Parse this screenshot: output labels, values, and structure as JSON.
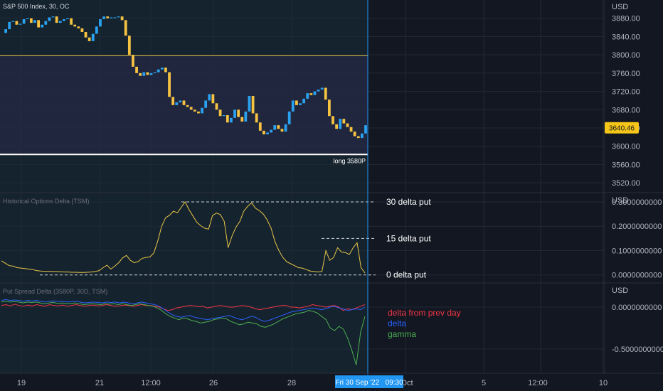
{
  "chart_data": [
    {
      "type": "candlestick",
      "title": "S&P 500 Index, 30, OC",
      "currency": "USD",
      "ylim": [
        3500,
        3920
      ],
      "yticks": [
        3520,
        3560,
        3600,
        3640,
        3680,
        3720,
        3760,
        3800,
        3840,
        3880
      ],
      "ytick_labels": [
        "3520.00",
        "3560.00",
        "3600.00",
        "3640.00",
        "3680.00",
        "3720.00",
        "3760.00",
        "3800.00",
        "3840.00",
        "3880.00"
      ],
      "last_price": "3640.46",
      "last_value": 3640.46,
      "levels": [
        {
          "value": 3798,
          "color": "#e8c547"
        },
        {
          "value": 3582,
          "color": "#ffffff",
          "label": "long 3580P"
        }
      ],
      "band": {
        "from": 3798,
        "to": 3582
      },
      "closes": [
        3848,
        3856,
        3872,
        3874,
        3866,
        3868,
        3878,
        3880,
        3870,
        3876,
        3860,
        3866,
        3874,
        3882,
        3884,
        3870,
        3874,
        3878,
        3880,
        3866,
        3862,
        3858,
        3850,
        3838,
        3830,
        3846,
        3862,
        3878,
        3884,
        3880,
        3882,
        3882,
        3884,
        3876,
        3842,
        3800,
        3774,
        3760,
        3754,
        3762,
        3756,
        3760,
        3762,
        3768,
        3772,
        3762,
        3708,
        3690,
        3696,
        3700,
        3690,
        3686,
        3680,
        3676,
        3672,
        3684,
        3700,
        3714,
        3694,
        3680,
        3666,
        3668,
        3652,
        3662,
        3680,
        3664,
        3654,
        3676,
        3710,
        3672,
        3652,
        3634,
        3626,
        3630,
        3636,
        3646,
        3638,
        3632,
        3648,
        3676,
        3700,
        3690,
        3694,
        3704,
        3716,
        3712,
        3720,
        3724,
        3728,
        3702,
        3666,
        3648,
        3638,
        3660,
        3650,
        3642,
        3632,
        3622,
        3618,
        3628,
        3646
      ]
    },
    {
      "type": "line",
      "title": "Historical Options Delta (TSM)",
      "currency": "USD",
      "ylim": [
        -0.03,
        0.335
      ],
      "yticks": [
        0,
        0.1,
        0.2,
        0.3
      ],
      "ytick_labels": [
        "0.0000000000",
        "0.1000000000",
        "0.2000000000",
        "0.3000000000"
      ],
      "color": "#e8c547",
      "annotations": [
        {
          "label": "30 delta put",
          "value": 0.3
        },
        {
          "label": "15 delta put",
          "value": 0.15
        },
        {
          "label": "0 delta put",
          "value": 0.0
        }
      ],
      "values": [
        0.058,
        0.048,
        0.038,
        0.036,
        0.03,
        0.028,
        0.026,
        0.024,
        0.022,
        0.018,
        0.016,
        0.015,
        0.015,
        0.014,
        0.014,
        0.013,
        0.012,
        0.012,
        0.011,
        0.011,
        0.01,
        0.01,
        0.011,
        0.012,
        0.014,
        0.018,
        0.03,
        0.04,
        0.024,
        0.036,
        0.05,
        0.07,
        0.08,
        0.06,
        0.05,
        0.055,
        0.068,
        0.072,
        0.074,
        0.09,
        0.14,
        0.2,
        0.235,
        0.245,
        0.262,
        0.255,
        0.278,
        0.3,
        0.268,
        0.242,
        0.216,
        0.202,
        0.192,
        0.188,
        0.244,
        0.254,
        0.248,
        0.22,
        0.112,
        0.16,
        0.196,
        0.22,
        0.262,
        0.282,
        0.296,
        0.274,
        0.264,
        0.25,
        0.226,
        0.192,
        0.136,
        0.1,
        0.072,
        0.054,
        0.046,
        0.038,
        0.03,
        0.028,
        0.022,
        0.016,
        0.014,
        0.012,
        0.014,
        0.1,
        0.06,
        0.072,
        0.112,
        0.094,
        0.092,
        0.084,
        0.112,
        0.132,
        0.03,
        0.008
      ]
    },
    {
      "type": "line",
      "title": "Put Spread Delta (3580P, 30D, TSM)",
      "currency": "USD",
      "ylim": [
        -0.78,
        0.28
      ],
      "yticks": [
        0,
        -0.5
      ],
      "ytick_labels": [
        "0.0000000000",
        "-0.5000000000"
      ],
      "series": [
        {
          "name": "delta from prev day",
          "color": "#f23645",
          "values": [
            0.02,
            0.03,
            0.015,
            0.035,
            0.02,
            0.01,
            0.025,
            0.015,
            0.03,
            0.02,
            0.01,
            0.03,
            0.02,
            0.015,
            0.025,
            0.01,
            0.02,
            0.03,
            0.02,
            0.01,
            0.02,
            0.025,
            0.015,
            0.02,
            0.03,
            0.02,
            0.01,
            0.015,
            0.025,
            0.02,
            0.01,
            0.02,
            0.03,
            0.02,
            0.02,
            0.01,
            0.0,
            -0.02,
            -0.04,
            -0.03,
            -0.01,
            0.0,
            0.01,
            0.02,
            0.015,
            0.005,
            0.01,
            -0.01,
            0.0,
            0.01,
            0.02,
            0.01,
            0.0,
            0.0,
            0.01,
            0.02,
            0.01,
            0.0,
            -0.02,
            -0.03,
            -0.02,
            -0.01,
            0.0,
            0.01,
            0.02,
            0.02,
            0.0,
            0.0,
            -0.01,
            0.0,
            0.01,
            0.03,
            0.02,
            0.01,
            0.0,
            0.01,
            0.02,
            0.0,
            -0.04,
            -0.02,
            -0.03,
            -0.01,
            0.01,
            0.03
          ]
        },
        {
          "name": "delta",
          "color": "#2962ff",
          "values": [
            0.08,
            0.09,
            0.08,
            0.085,
            0.08,
            0.07,
            0.08,
            0.075,
            0.08,
            0.07,
            0.06,
            0.07,
            0.075,
            0.065,
            0.07,
            0.06,
            0.065,
            0.07,
            0.06,
            0.05,
            0.055,
            0.06,
            0.055,
            0.05,
            0.06,
            0.055,
            0.06,
            0.05,
            0.06,
            0.05,
            0.04,
            0.05,
            0.06,
            0.05,
            0.04,
            0.03,
            0.01,
            -0.02,
            -0.06,
            -0.09,
            -0.11,
            -0.12,
            -0.11,
            -0.1,
            -0.12,
            -0.13,
            -0.14,
            -0.15,
            -0.14,
            -0.13,
            -0.12,
            -0.11,
            -0.1,
            -0.12,
            -0.14,
            -0.15,
            -0.13,
            -0.11,
            -0.12,
            -0.15,
            -0.17,
            -0.16,
            -0.14,
            -0.12,
            -0.1,
            -0.08,
            -0.06,
            -0.05,
            -0.04,
            -0.03,
            -0.02,
            -0.01,
            -0.02,
            -0.03,
            -0.02,
            0.0,
            0.01,
            -0.01,
            -0.02,
            -0.04,
            -0.03,
            -0.02,
            -0.03,
            0.0
          ]
        },
        {
          "name": "gamma",
          "color": "#4caf50",
          "values": [
            0.06,
            0.07,
            0.06,
            0.065,
            0.06,
            0.05,
            0.06,
            0.055,
            0.06,
            0.05,
            0.04,
            0.05,
            0.055,
            0.045,
            0.05,
            0.04,
            0.045,
            0.05,
            0.04,
            0.03,
            0.035,
            0.04,
            0.035,
            0.03,
            0.04,
            0.035,
            0.04,
            0.03,
            0.04,
            0.03,
            0.02,
            0.03,
            0.04,
            0.03,
            0.02,
            0.01,
            -0.01,
            -0.04,
            -0.08,
            -0.11,
            -0.13,
            -0.15,
            -0.13,
            -0.14,
            -0.16,
            -0.17,
            -0.19,
            -0.18,
            -0.17,
            -0.15,
            -0.14,
            -0.13,
            -0.14,
            -0.17,
            -0.19,
            -0.21,
            -0.2,
            -0.18,
            -0.19,
            -0.2,
            -0.23,
            -0.24,
            -0.22,
            -0.2,
            -0.17,
            -0.14,
            -0.12,
            -0.1,
            -0.08,
            -0.07,
            -0.06,
            -0.04,
            -0.05,
            -0.07,
            -0.11,
            -0.15,
            -0.25,
            -0.28,
            -0.23,
            -0.26,
            -0.37,
            -0.52,
            -0.69,
            -0.3,
            -0.11
          ]
        }
      ],
      "legend_location": "right of plot"
    }
  ],
  "x_axis": {
    "tick_labels": [
      "19",
      "21",
      "12:00",
      "26",
      "28",
      "Oct",
      "5",
      "12:00",
      "10"
    ],
    "crosshair_label": "Fri 30 Sep '22   09:30"
  }
}
